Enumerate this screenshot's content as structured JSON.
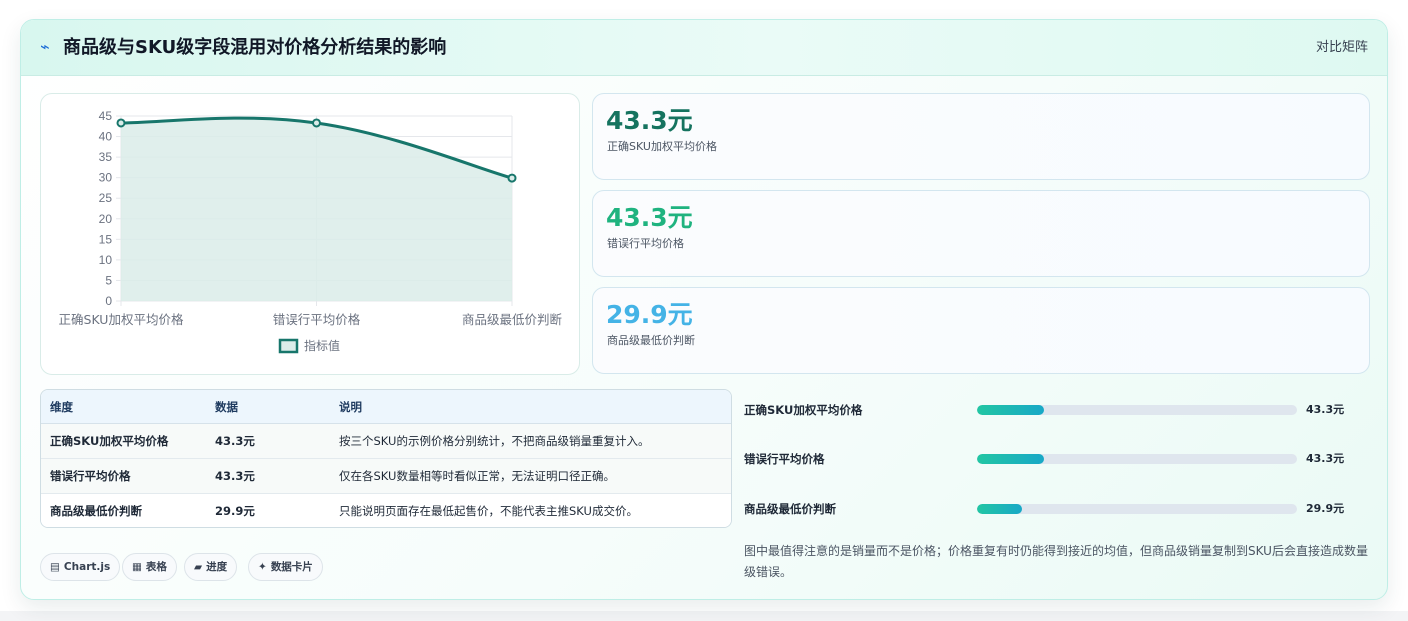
{
  "header": {
    "icon": "lightning-icon",
    "title": "商品级与SKU级字段混用对价格分析结果的影响",
    "action_label": "对比矩阵"
  },
  "chart_data": {
    "type": "area",
    "categories": [
      "正确SKU加权平均价格",
      "错误行平均价格",
      "商品级最低价判断"
    ],
    "series": [
      {
        "name": "指标值",
        "values": [
          43.3,
          43.3,
          29.9
        ]
      }
    ],
    "ylim": [
      0,
      45
    ],
    "yticks": [
      0,
      5,
      10,
      15,
      20,
      25,
      30,
      35,
      40,
      45
    ],
    "grid": true,
    "legend": "bottom",
    "colors": {
      "line": "#17766b",
      "fill": "#dbece9"
    }
  },
  "stats": [
    {
      "value": "43.3元",
      "label": "正确SKU加权平均价格",
      "color": "#15735f"
    },
    {
      "value": "43.3元",
      "label": "错误行平均价格",
      "color": "#1fb37f"
    },
    {
      "value": "29.9元",
      "label": "商品级最低价判断",
      "color": "#44b3e6"
    }
  ],
  "table": {
    "headers": [
      "维度",
      "数据",
      "说明"
    ],
    "rows": [
      [
        "正确SKU加权平均价格",
        "43.3元",
        "按三个SKU的示例价格分别统计，不把商品级销量重复计入。"
      ],
      [
        "错误行平均价格",
        "43.3元",
        "仅在各SKU数量相等时看似正常，无法证明口径正确。"
      ],
      [
        "商品级最低价判断",
        "29.9元",
        "只能说明页面存在最低起售价，不能代表主推SKU成交价。"
      ]
    ]
  },
  "bars": [
    {
      "label": "正确SKU加权平均价格",
      "value_text": "43.3元",
      "fraction": 0.21
    },
    {
      "label": "错误行平均价格",
      "value_text": "43.3元",
      "fraction": 0.21
    },
    {
      "label": "商品级最低价判断",
      "value_text": "29.9元",
      "fraction": 0.14
    }
  ],
  "note": "图中最值得注意的是销量而不是价格；价格重复有时仍能得到接近的均值，但商品级销量复制到SKU后会直接造成数量级错误。",
  "chips": [
    {
      "icon": "▤",
      "label": "Chart.js"
    },
    {
      "icon": "▦",
      "label": "表格"
    },
    {
      "icon": "▰",
      "label": "进度"
    },
    {
      "icon": "✦",
      "label": "数据卡片"
    }
  ]
}
